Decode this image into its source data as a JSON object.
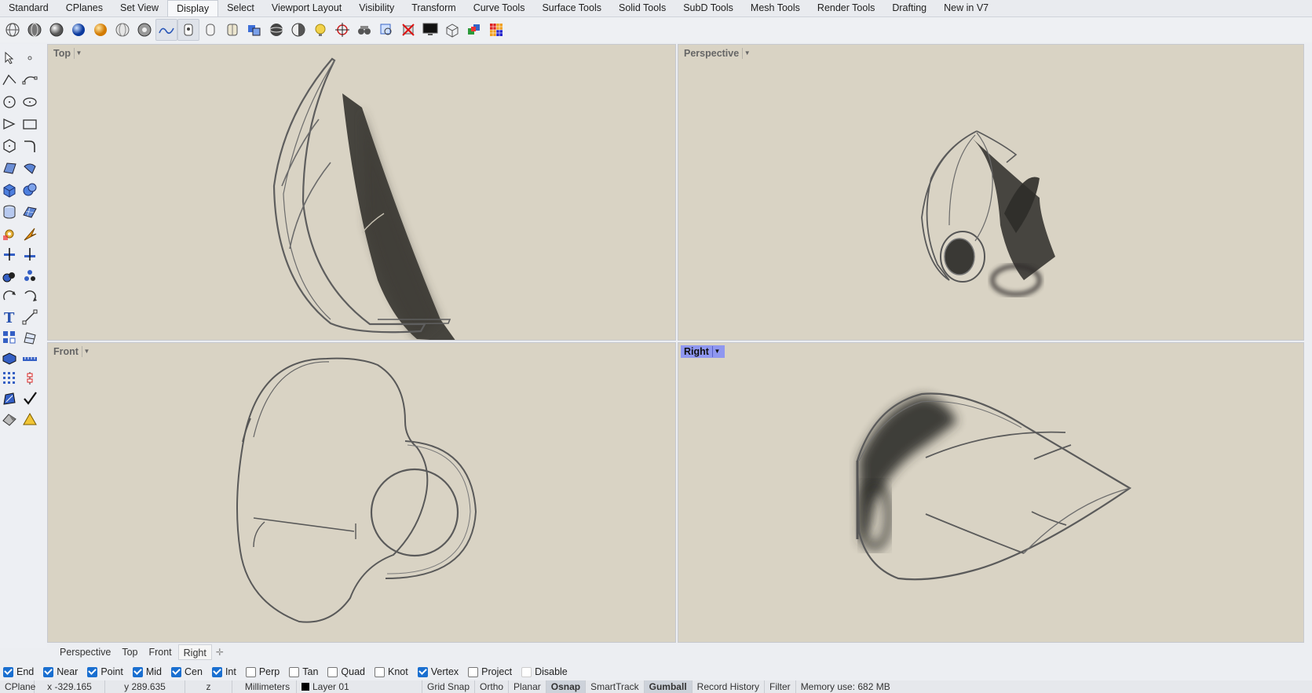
{
  "tabs": [
    {
      "label": "Standard",
      "active": false
    },
    {
      "label": "CPlanes",
      "active": false
    },
    {
      "label": "Set View",
      "active": false
    },
    {
      "label": "Display",
      "active": true
    },
    {
      "label": "Select",
      "active": false
    },
    {
      "label": "Viewport Layout",
      "active": false
    },
    {
      "label": "Visibility",
      "active": false
    },
    {
      "label": "Transform",
      "active": false
    },
    {
      "label": "Curve Tools",
      "active": false
    },
    {
      "label": "Surface Tools",
      "active": false
    },
    {
      "label": "Solid Tools",
      "active": false
    },
    {
      "label": "SubD Tools",
      "active": false
    },
    {
      "label": "Mesh Tools",
      "active": false
    },
    {
      "label": "Render Tools",
      "active": false
    },
    {
      "label": "Drafting",
      "active": false
    },
    {
      "label": "New in V7",
      "active": false
    }
  ],
  "viewports": {
    "top": {
      "title": "Top"
    },
    "perspective": {
      "title": "Perspective"
    },
    "front": {
      "title": "Front"
    },
    "right": {
      "title": "Right"
    }
  },
  "viewport_tabs": [
    "Perspective",
    "Top",
    "Front",
    "Right"
  ],
  "osnaps": [
    {
      "label": "End",
      "checked": true
    },
    {
      "label": "Near",
      "checked": true
    },
    {
      "label": "Point",
      "checked": true
    },
    {
      "label": "Mid",
      "checked": true
    },
    {
      "label": "Cen",
      "checked": true
    },
    {
      "label": "Int",
      "checked": true
    },
    {
      "label": "Perp",
      "checked": false
    },
    {
      "label": "Tan",
      "checked": false
    },
    {
      "label": "Quad",
      "checked": false
    },
    {
      "label": "Knot",
      "checked": false
    },
    {
      "label": "Vertex",
      "checked": true
    },
    {
      "label": "Project",
      "checked": false
    },
    {
      "label": "Disable",
      "checked": false
    }
  ],
  "status": {
    "cplane": "CPlane",
    "x": "x -329.165",
    "y": "y 289.635",
    "z": "z",
    "units": "Millimeters",
    "layer": "Layer 01",
    "grid_snap": "Grid Snap",
    "ortho": "Ortho",
    "planar": "Planar",
    "osnap": "Osnap",
    "smarttrack": "SmartTrack",
    "gumball": "Gumball",
    "record_history": "Record History",
    "filter": "Filter",
    "memory": "Memory use: 682 MB"
  },
  "colors": {
    "viewport_bg": "#d9d3c4",
    "active_viewport_title": "#8f97f0",
    "checkbox_on": "#1a6fd0",
    "layer_swatch": "#000000"
  }
}
